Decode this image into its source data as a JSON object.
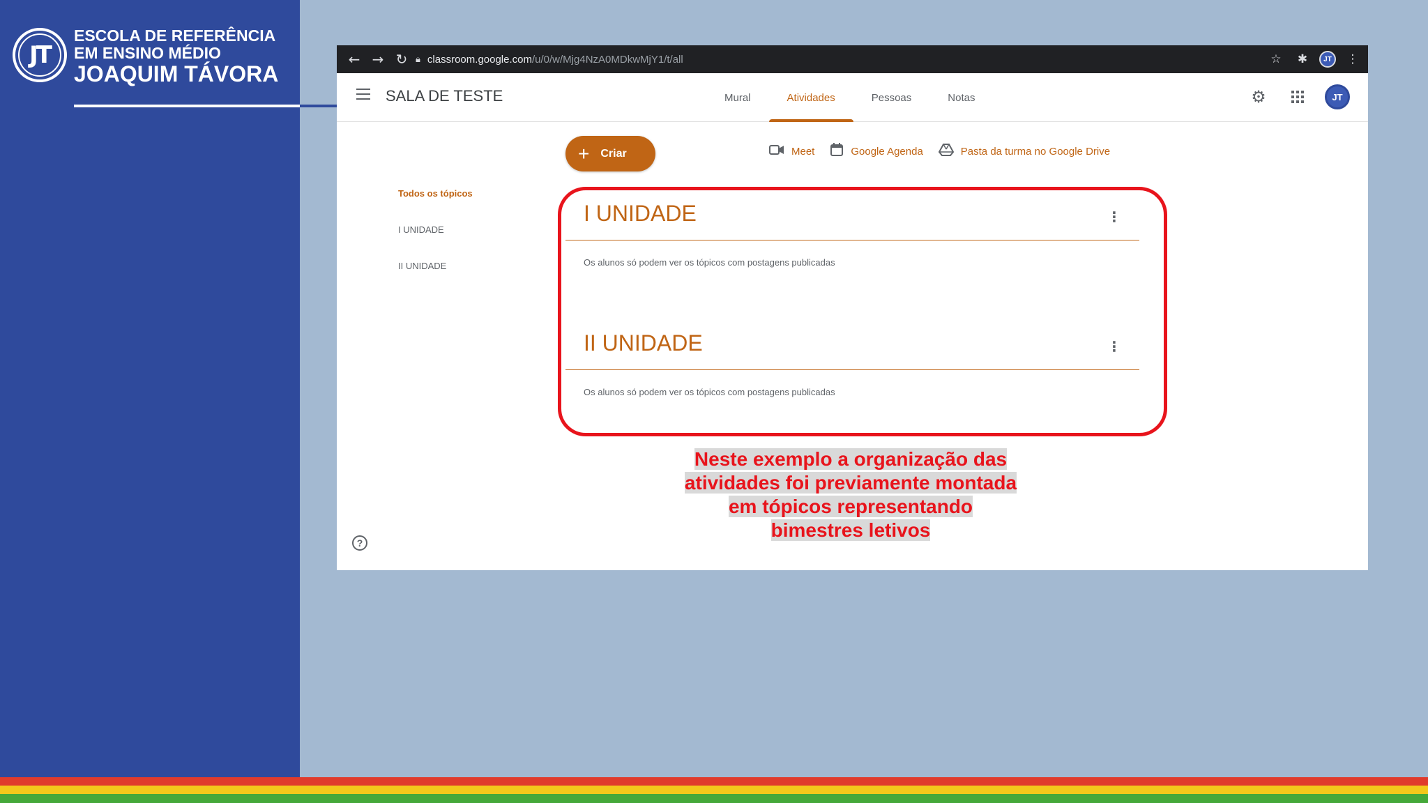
{
  "school": {
    "logo_text": "JT",
    "line1": "ESCOLA DE REFERÊNCIA",
    "line2": "EM ENSINO MÉDIO",
    "line3": "JOAQUIM TÁVORA"
  },
  "browser": {
    "url_host": "classroom.google.com",
    "url_path": "/u/0/w/Mjg4NzA0MDkwMjY1/t/all",
    "avatar_text": "JT"
  },
  "classroom": {
    "class_name": "SALA DE TESTE",
    "tabs": [
      {
        "label": "Mural",
        "active": false
      },
      {
        "label": "Atividades",
        "active": true
      },
      {
        "label": "Pessoas",
        "active": false
      },
      {
        "label": "Notas",
        "active": false
      }
    ],
    "avatar_text": "JT",
    "create_label": "Criar",
    "quick_links": {
      "meet": "Meet",
      "calendar": "Google Agenda",
      "drive": "Pasta da turma no Google Drive"
    },
    "topic_nav": [
      "Todos os tópicos",
      "I UNIDADE",
      "II UNIDADE"
    ],
    "topics": [
      {
        "title": "I UNIDADE",
        "note": "Os alunos só podem ver os tópicos com postagens publicadas"
      },
      {
        "title": "II UNIDADE",
        "note": "Os alunos só podem ver os tópicos com postagens publicadas"
      }
    ]
  },
  "annotation": {
    "lines": [
      "Neste exemplo a organização das",
      "atividades foi previamente montada",
      "em tópicos representando",
      "bimestres letivos"
    ]
  },
  "colors": {
    "accent": "#c06515",
    "highlight": "#e8141c",
    "panel": "#2f4a9c",
    "background": "#a3b9d1"
  }
}
